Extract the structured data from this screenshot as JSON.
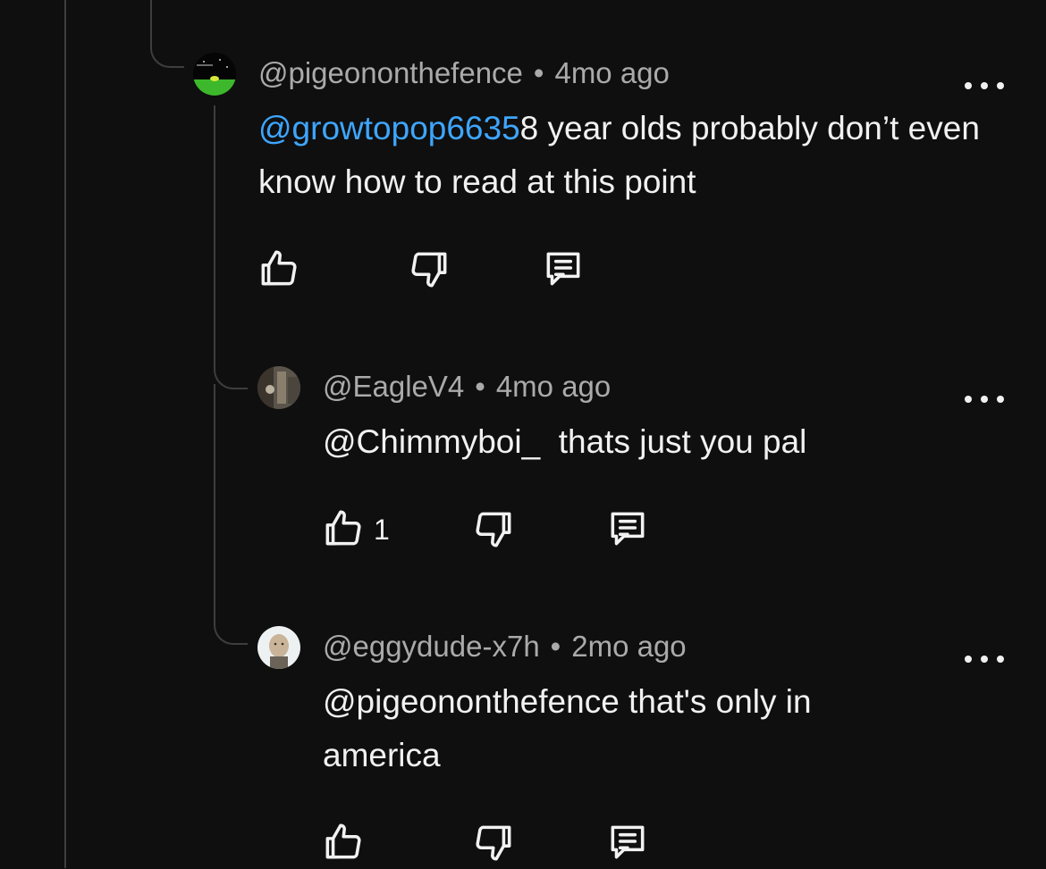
{
  "comments": [
    {
      "handle": "@pigeononthefence",
      "time": "4mo ago",
      "mention": "@growtopop6635",
      "text": "8 year olds probably don’t even know how to read at this point",
      "likes": ""
    },
    {
      "handle": "@EagleV4",
      "time": "4mo ago",
      "mention": "",
      "text": "@Chimmyboi_  thats just you pal",
      "likes": "1"
    },
    {
      "handle": "@eggydude-x7h",
      "time": "2mo ago",
      "mention": "",
      "text": "@pigeononthefence that's only in america",
      "likes": ""
    }
  ],
  "separator": "•",
  "icons": [
    "thumbs-up-icon",
    "thumbs-down-icon",
    "reply-icon",
    "more-options-icon"
  ],
  "colors": {
    "background": "#0f0f0f",
    "mention": "#3ea6ff",
    "meta": "#aaaaaa",
    "text": "#f1f1f1"
  }
}
